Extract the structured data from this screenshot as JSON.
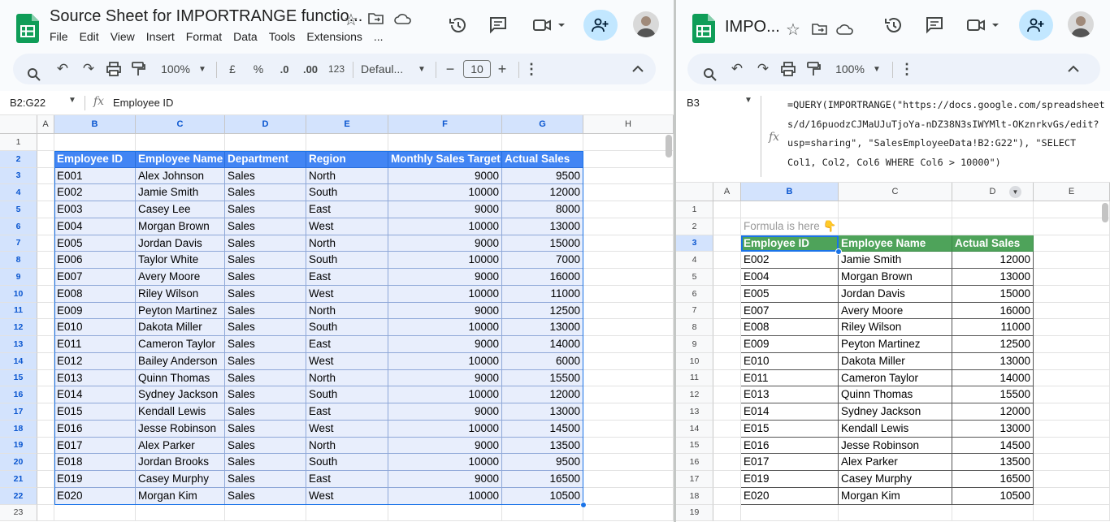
{
  "left": {
    "title": "Source Sheet for IMPORTRANGE functio...",
    "menu": [
      "File",
      "Edit",
      "View",
      "Insert",
      "Format",
      "Data",
      "Tools",
      "Extensions",
      "..."
    ],
    "toolbar": {
      "zoom": "100%",
      "currency": "£",
      "percent": "%",
      "dec_decrease": ".0",
      "dec_increase": ".00",
      "format_123": "123",
      "font": "Defaul...",
      "font_size": "10",
      "minus": "−",
      "plus": "+"
    },
    "namebox": "B2:G22",
    "formula": "Employee ID",
    "columns": [
      "A",
      "B",
      "C",
      "D",
      "E",
      "F",
      "G",
      "H"
    ],
    "rows": [
      "1",
      "2",
      "3",
      "4",
      "5",
      "6",
      "7",
      "8",
      "9",
      "10",
      "11",
      "12",
      "13",
      "14",
      "15",
      "16",
      "17",
      "18",
      "19",
      "20",
      "21",
      "22",
      "23"
    ],
    "headers": [
      "Employee ID",
      "Employee Name",
      "Department",
      "Region",
      "Monthly Sales Target",
      "Actual Sales"
    ],
    "data": [
      [
        "E001",
        "Alex Johnson",
        "Sales",
        "North",
        "9000",
        "9500"
      ],
      [
        "E002",
        "Jamie Smith",
        "Sales",
        "South",
        "10000",
        "12000"
      ],
      [
        "E003",
        "Casey Lee",
        "Sales",
        "East",
        "9000",
        "8000"
      ],
      [
        "E004",
        "Morgan Brown",
        "Sales",
        "West",
        "10000",
        "13000"
      ],
      [
        "E005",
        "Jordan Davis",
        "Sales",
        "North",
        "9000",
        "15000"
      ],
      [
        "E006",
        "Taylor White",
        "Sales",
        "South",
        "10000",
        "7000"
      ],
      [
        "E007",
        "Avery Moore",
        "Sales",
        "East",
        "9000",
        "16000"
      ],
      [
        "E008",
        "Riley Wilson",
        "Sales",
        "West",
        "10000",
        "11000"
      ],
      [
        "E009",
        "Peyton Martinez",
        "Sales",
        "North",
        "9000",
        "12500"
      ],
      [
        "E010",
        "Dakota Miller",
        "Sales",
        "South",
        "10000",
        "13000"
      ],
      [
        "E011",
        "Cameron Taylor",
        "Sales",
        "East",
        "9000",
        "14000"
      ],
      [
        "E012",
        "Bailey Anderson",
        "Sales",
        "West",
        "10000",
        "6000"
      ],
      [
        "E013",
        "Quinn Thomas",
        "Sales",
        "North",
        "9000",
        "15500"
      ],
      [
        "E014",
        "Sydney Jackson",
        "Sales",
        "South",
        "10000",
        "12000"
      ],
      [
        "E015",
        "Kendall Lewis",
        "Sales",
        "East",
        "9000",
        "13000"
      ],
      [
        "E016",
        "Jesse Robinson",
        "Sales",
        "West",
        "10000",
        "14500"
      ],
      [
        "E017",
        "Alex Parker",
        "Sales",
        "North",
        "9000",
        "13500"
      ],
      [
        "E018",
        "Jordan Brooks",
        "Sales",
        "South",
        "10000",
        "9500"
      ],
      [
        "E019",
        "Casey Murphy",
        "Sales",
        "East",
        "9000",
        "16500"
      ],
      [
        "E020",
        "Morgan Kim",
        "Sales",
        "West",
        "10000",
        "10500"
      ]
    ]
  },
  "right": {
    "title": "IMPO...",
    "toolbar": {
      "zoom": "100%"
    },
    "namebox": "B3",
    "formula_lines": [
      "=QUERY(IMPORTRANGE(\"https://docs.google.com/spreadsheet",
      "s/d/16puodzCJMaUJuTjoYa-nDZ38N3sIWYMlt-OKznrkvGs/edit?",
      "usp=sharing\", \"SalesEmployeeData!B2:G22\"), \"SELECT",
      "Col1, Col2, Col6 WHERE Col6 > 10000\")"
    ],
    "columns": [
      "A",
      "B",
      "C",
      "D",
      "E"
    ],
    "rows": [
      "1",
      "2",
      "3",
      "4",
      "5",
      "6",
      "7",
      "8",
      "9",
      "10",
      "11",
      "12",
      "13",
      "14",
      "15",
      "16",
      "17",
      "18",
      "19"
    ],
    "note": "Formula is here 👇",
    "headers": [
      "Employee ID",
      "Employee Name",
      "Actual Sales"
    ],
    "data": [
      [
        "E002",
        "Jamie Smith",
        "12000"
      ],
      [
        "E004",
        "Morgan Brown",
        "13000"
      ],
      [
        "E005",
        "Jordan Davis",
        "15000"
      ],
      [
        "E007",
        "Avery Moore",
        "16000"
      ],
      [
        "E008",
        "Riley Wilson",
        "11000"
      ],
      [
        "E009",
        "Peyton Martinez",
        "12500"
      ],
      [
        "E010",
        "Dakota Miller",
        "13000"
      ],
      [
        "E011",
        "Cameron Taylor",
        "14000"
      ],
      [
        "E013",
        "Quinn Thomas",
        "15500"
      ],
      [
        "E014",
        "Sydney Jackson",
        "12000"
      ],
      [
        "E015",
        "Kendall Lewis",
        "13000"
      ],
      [
        "E016",
        "Jesse Robinson",
        "14500"
      ],
      [
        "E017",
        "Alex Parker",
        "13500"
      ],
      [
        "E019",
        "Casey Murphy",
        "16500"
      ],
      [
        "E020",
        "Morgan Kim",
        "10500"
      ]
    ]
  },
  "colors": {
    "accent": "#0b57d0",
    "header_blue": "#4285f4",
    "header_green": "#4ea35a",
    "selection": "#e8eefc",
    "sheets_green": "#0f9d58"
  },
  "icons": [
    "sheets-logo-icon",
    "star-icon",
    "move-folder-icon",
    "cloud-icon",
    "history-icon",
    "comment-icon",
    "meet-icon",
    "share-icon",
    "avatar",
    "search-icon",
    "undo-icon",
    "redo-icon",
    "print-icon",
    "paint-format-icon",
    "more-icon",
    "collapse-icon",
    "fx-icon"
  ]
}
